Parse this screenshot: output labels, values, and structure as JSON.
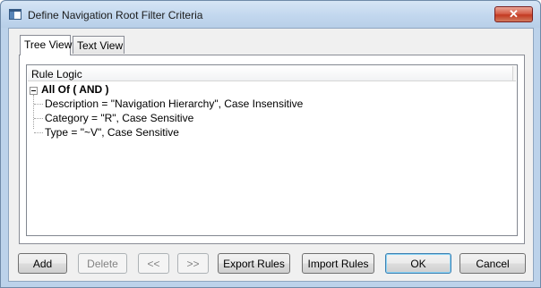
{
  "window": {
    "title": "Define Navigation Root Filter Criteria"
  },
  "titlebar": {
    "close_label": "✕"
  },
  "tabs": [
    {
      "label": "Tree View",
      "active": true
    },
    {
      "label": "Text View",
      "active": false
    }
  ],
  "tree": {
    "column_header": "Rule Logic",
    "root": {
      "label": "All Of ( AND )",
      "children": [
        {
          "label": "Description = \"Navigation Hierarchy\", Case Insensitive"
        },
        {
          "label": "Category = \"R\", Case Sensitive"
        },
        {
          "label": "Type = \"~V\", Case Sensitive"
        }
      ]
    }
  },
  "buttons": {
    "add": "Add",
    "delete": "Delete",
    "prev": "<<",
    "next": ">>",
    "export_rules": "Export Rules",
    "import_rules": "Import Rules",
    "ok": "OK",
    "cancel": "Cancel"
  },
  "colors": {
    "titlebar": "#c2d7ee",
    "close_button": "#c9432a",
    "dialog_background": "#f0f0f0"
  }
}
